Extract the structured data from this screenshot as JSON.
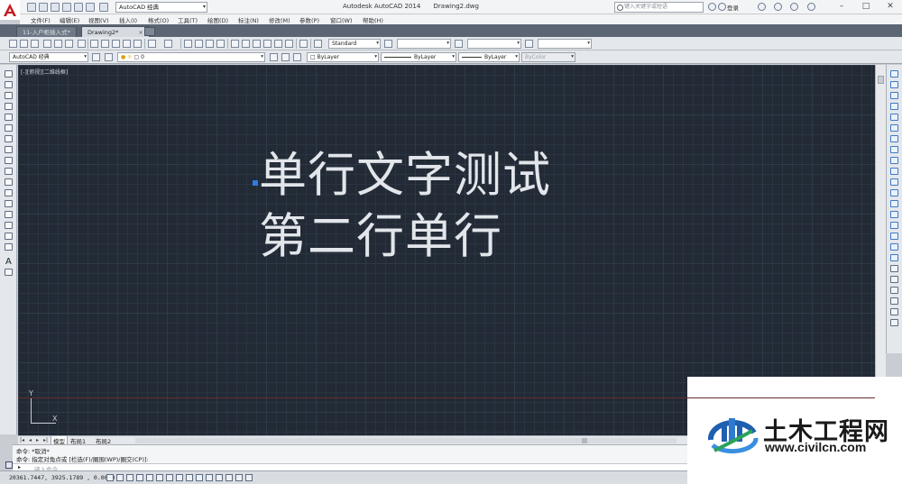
{
  "titlebar": {
    "app_name": "Autodesk AutoCAD 2014",
    "document_name": "Drawing2.dwg",
    "workspace": "AutoCAD 经典",
    "search_placeholder": "键入关键字或短语",
    "sign_in": "登录"
  },
  "menu": [
    "文件(F)",
    "编辑(E)",
    "视图(V)",
    "插入(I)",
    "格式(O)",
    "工具(T)",
    "绘图(D)",
    "标注(N)",
    "修改(M)",
    "参数(P)",
    "窗口(W)",
    "帮助(H)"
  ],
  "doc_tabs": [
    {
      "label": "11-入户柜插入式*",
      "active": false
    },
    {
      "label": "Drawing2*",
      "active": true
    }
  ],
  "toolbar": {
    "text_style": "Standard",
    "workspace_combo": "AutoCAD 经典",
    "layer": "0",
    "color": "ByLayer",
    "linetype": "ByLayer",
    "lineweight": "ByLayer",
    "plotstyle": "ByColor"
  },
  "canvas": {
    "viewport_label": "[-][俯视][二维线框]",
    "text_line_1": "单行文字测试",
    "text_line_2": "第二行单行",
    "ucs_y": "Y",
    "ucs_x": "X",
    "grip_color": "#2c7de0",
    "background_color": "#222a35"
  },
  "left_palette": {
    "text_tool_glyph": "A"
  },
  "layout_tabs": [
    "模型",
    "布局1",
    "布局2"
  ],
  "command_line": {
    "history": [
      "命令: *取消*",
      "命令: 指定对角点或 [栏选(F)/圈围(WP)/圈交(CP)]:"
    ],
    "prompt": "键入命令"
  },
  "status": {
    "coordinates": "20361.7447, 3925.1789 , 0.0000"
  },
  "watermark": {
    "name": "土木工程网",
    "url": "www.civilcn.com"
  }
}
